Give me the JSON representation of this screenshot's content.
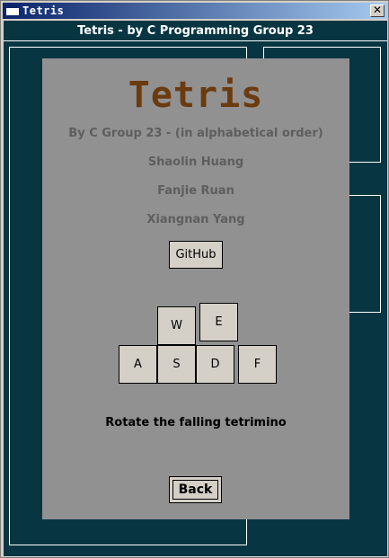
{
  "window": {
    "title": "Tetris",
    "close_glyph": "✕",
    "icon": "window-icon"
  },
  "header": {
    "title": "Tetris - by C Programming Group 23"
  },
  "dialog": {
    "app_title": "Tetris",
    "subtitle": "By C Group 23 - (in alphabetical order)",
    "authors": [
      "Shaolin Huang",
      "Fanjie Ruan",
      "Xiangnan Yang"
    ],
    "github_label": "GitHub",
    "keys": {
      "w": "W",
      "e": "E",
      "a": "A",
      "s": "S",
      "d": "D",
      "f": "F"
    },
    "description": "Rotate the falling tetrimino",
    "back_label": "Back"
  },
  "colors": {
    "client_bg": "#073642",
    "panel_bg": "#919191",
    "title_color": "#6b3a0e",
    "credit_color": "#5e5e5e"
  }
}
